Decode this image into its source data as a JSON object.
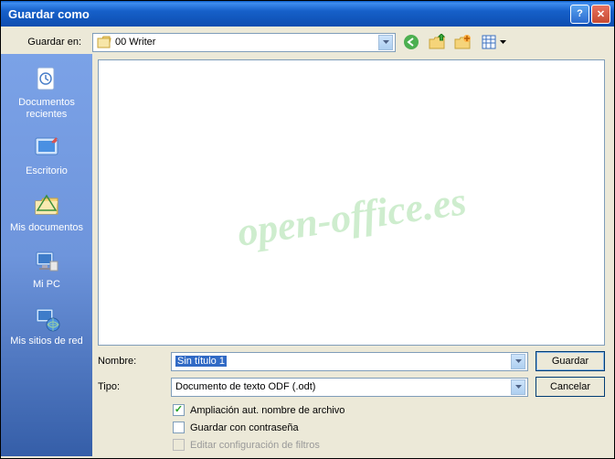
{
  "titlebar": {
    "title": "Guardar como"
  },
  "toolbar": {
    "save_in_label": "Guardar en:",
    "location": "00 Writer"
  },
  "sidebar": {
    "items": [
      {
        "label": "Documentos recientes"
      },
      {
        "label": "Escritorio"
      },
      {
        "label": "Mis documentos"
      },
      {
        "label": "Mi PC"
      },
      {
        "label": "Mis sitios de red"
      }
    ]
  },
  "form": {
    "name_label": "Nombre:",
    "name_value": "Sin título 1",
    "type_label": "Tipo:",
    "type_value": "Documento de texto ODF (.odt)",
    "save_button": "Guardar",
    "cancel_button": "Cancelar"
  },
  "checks": {
    "auto_ext": "Ampliación aut. nombre de archivo",
    "password": "Guardar con contraseña",
    "filter": "Editar configuración de filtros"
  },
  "watermark": "open-office.es"
}
